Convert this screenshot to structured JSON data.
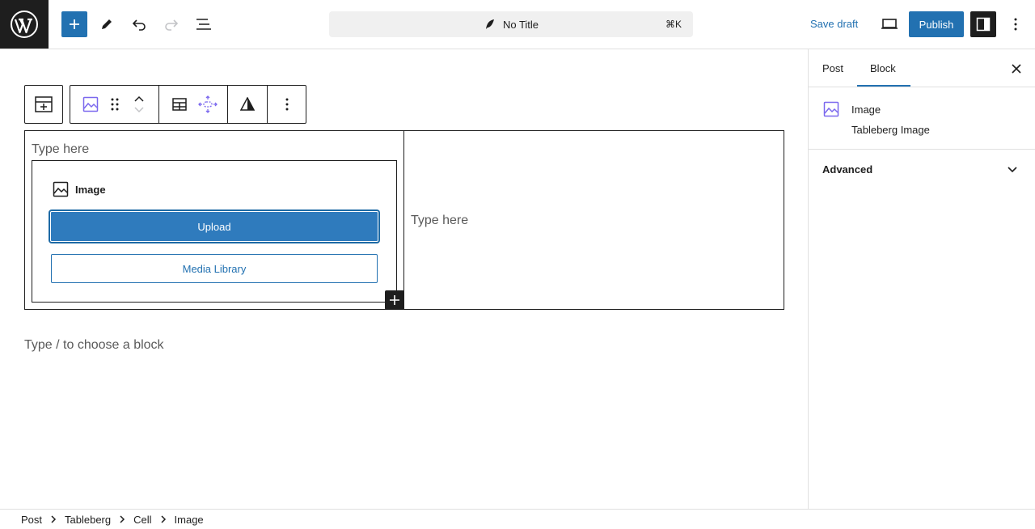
{
  "header": {
    "logo_icon": "wordpress-logo-icon",
    "document_title": "No Title",
    "command_shortcut": "⌘K",
    "save_draft_label": "Save draft",
    "publish_label": "Publish"
  },
  "block_toolbar": {
    "icons": [
      "table-parent-icon",
      "image-icon",
      "drag-handle-icon",
      "move-up-icon",
      "move-down-icon",
      "table-icon",
      "alignment-icon",
      "contrast-icon",
      "more-options-icon"
    ]
  },
  "table": {
    "left_cell_placeholder": "Type here",
    "right_cell_placeholder": "Type here",
    "image_block": {
      "title": "Image",
      "upload_label": "Upload",
      "media_library_label": "Media Library"
    }
  },
  "appender_placeholder": "Type / to choose a block",
  "sidebar": {
    "tabs": [
      {
        "label": "Post"
      },
      {
        "label": "Block"
      }
    ],
    "active_tab": "Block",
    "block_card": {
      "title": "Image",
      "description": "Tableberg Image"
    },
    "panels": [
      {
        "label": "Advanced",
        "expanded": false
      }
    ]
  },
  "breadcrumb": [
    "Post",
    "Tableberg",
    "Cell",
    "Image"
  ],
  "colors": {
    "accent": "#2271b1",
    "dark": "#1e1e1e",
    "block_icon": "#7b68ee"
  }
}
